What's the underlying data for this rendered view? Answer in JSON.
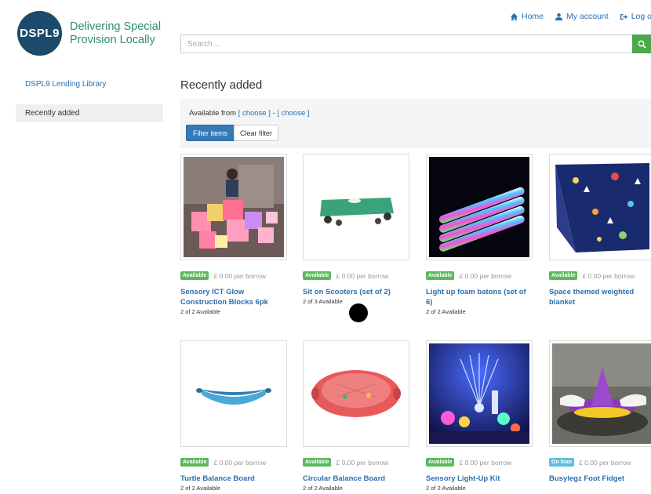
{
  "header": {
    "logo_abbr": "DSPL9",
    "logo_line1": "Delivering Special",
    "logo_line2": "Provision Locally",
    "nav": {
      "home": "Home",
      "account": "My account",
      "logout": "Log ou"
    },
    "search_placeholder": "Search ..."
  },
  "sidebar": {
    "library_link": "DSPL9 Lending Library",
    "recently_added": "Recently added"
  },
  "main": {
    "title": "Recently added",
    "filter": {
      "available_from": "Available from",
      "choose1": "[ choose ]",
      "dash": " - ",
      "choose2": "[ choose ]",
      "filter_btn": "Filter items",
      "clear_btn": "Clear filter"
    },
    "items": [
      {
        "badge": "Available",
        "price": "£ 0.00 per borrow",
        "name": "Sensory ICT Glow Construction Blocks 6pk",
        "avail": "2 of 2 Available"
      },
      {
        "badge": "Available",
        "price": "£ 0.00 per borrow",
        "name": "Sit on Scooters (set of 2)",
        "avail": "2 of 3 Available"
      },
      {
        "badge": "Available",
        "price": "£ 0.00 per borrow",
        "name": "Light up foam batons (set of 6)",
        "avail": "2 of 2 Available"
      },
      {
        "badge": "Available",
        "price": "£ 0.00 per borrow",
        "name": "Space themed weighted blanket",
        "avail": ""
      },
      {
        "badge": "Available",
        "price": "£ 0.00 per borrow",
        "name": "Turtle Balance Board",
        "avail": "2 of 2 Available"
      },
      {
        "badge": "Available",
        "price": "£ 0.00 per borrow",
        "name": "Circular Balance Board",
        "avail": "2 of 2 Available"
      },
      {
        "badge": "Available",
        "price": "£ 0.00 per borrow",
        "name": "Sensory Light-Up Kit",
        "avail": "2 of 2 Available"
      },
      {
        "badge": "On loan",
        "price": "£ 0.00 per borrow",
        "name": "Busylegz Foot Fidget",
        "avail": ""
      }
    ]
  },
  "colors": {
    "brand_navy": "#1b4a6b",
    "brand_green": "#2f8f6b",
    "link": "#2a6fb0",
    "available": "#5cb85c",
    "on_loan": "#5bc0de",
    "primary": "#337ab7"
  }
}
